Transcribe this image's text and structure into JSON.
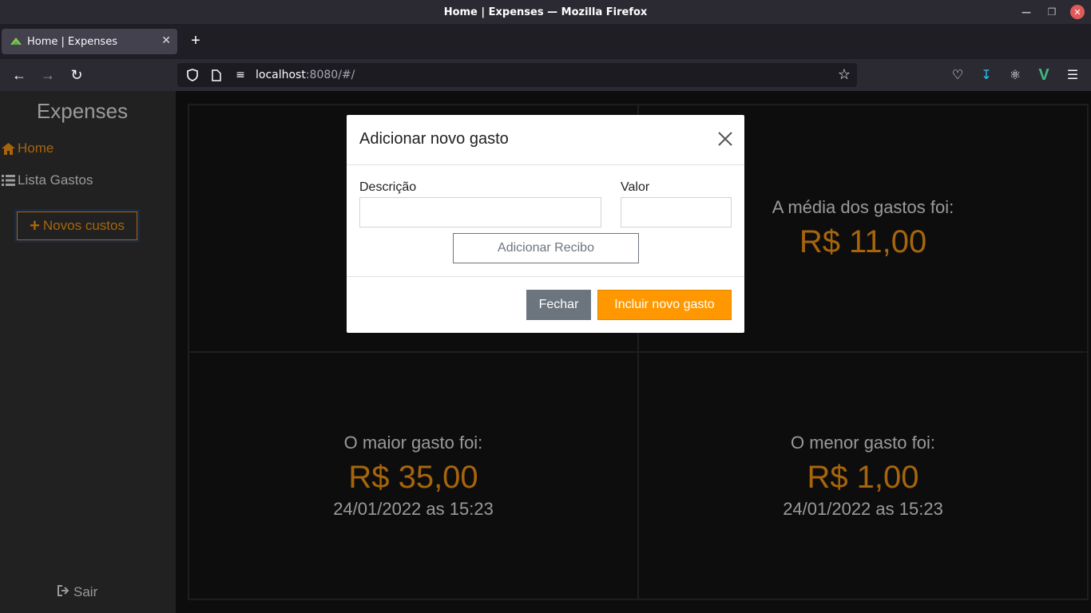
{
  "window": {
    "title": "Home | Expenses — Mozilla Firefox"
  },
  "browser": {
    "tab_title": "Home | Expenses",
    "url_host": "localhost",
    "url_rest": ":8080/#/"
  },
  "sidebar": {
    "brand": "Expenses",
    "items": [
      {
        "label": "Home",
        "icon": "home-icon"
      },
      {
        "label": "Lista Gastos",
        "icon": "list-icon"
      }
    ],
    "new_button": "Novos custos",
    "logout": "Sair"
  },
  "stats": {
    "average": {
      "label": "A média dos gastos foi:",
      "amount": "R$ 11,00"
    },
    "max": {
      "label": "O maior gasto foi:",
      "amount": "R$ 35,00",
      "date": "24/01/2022 as 15:23"
    },
    "min": {
      "label": "O menor gasto foi:",
      "amount": "R$ 1,00",
      "date": "24/01/2022 as 15:23"
    }
  },
  "modal": {
    "title": "Adicionar novo gasto",
    "description_label": "Descrição",
    "description_value": "",
    "value_label": "Valor",
    "value_value": "",
    "receipt_button": "Adicionar Recibo",
    "close_button": "Fechar",
    "submit_button": "Incluir novo gasto"
  },
  "colors": {
    "accent": "#a7650b",
    "submit": "#ff9800",
    "secondary": "#6c757d"
  }
}
